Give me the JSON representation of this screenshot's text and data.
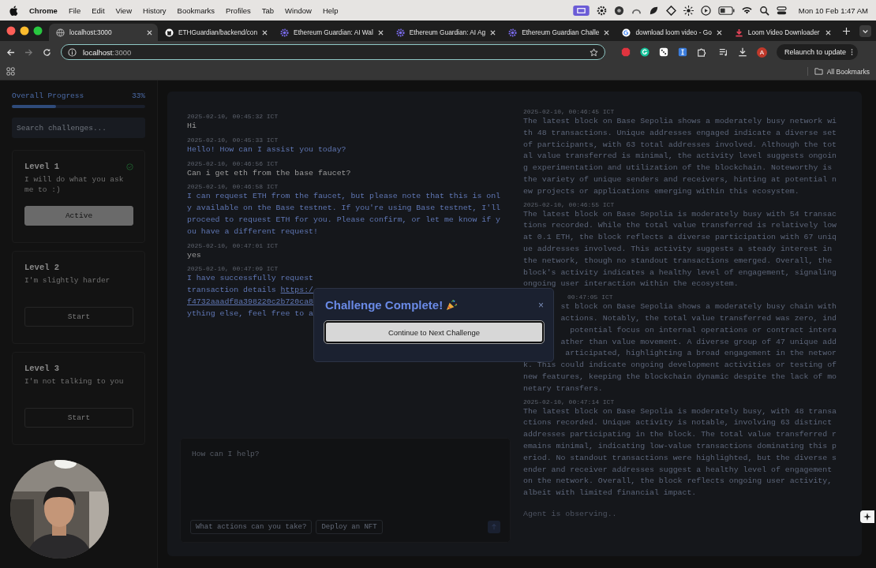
{
  "menu_bar": {
    "app": "Chrome",
    "menus": [
      "File",
      "Edit",
      "View",
      "History",
      "Bookmarks",
      "Profiles",
      "Tab",
      "Window",
      "Help"
    ],
    "clock": "Mon 10 Feb  1:47 AM"
  },
  "tabs": [
    {
      "title": "localhost:3000",
      "selected": true
    },
    {
      "title": "ETHGuardian/backend/con",
      "selected": false
    },
    {
      "title": "Ethereum Guardian: AI Wal",
      "selected": false
    },
    {
      "title": "Ethereum Guardian: AI Ag",
      "selected": false
    },
    {
      "title": "Ethereum Guardian Challe",
      "selected": false
    },
    {
      "title": "download loom video - Go",
      "selected": false
    },
    {
      "title": "Loom Video Downloader",
      "selected": false
    }
  ],
  "address_bar": {
    "host": "localhost",
    "port": ":3000"
  },
  "profile_initial": "A",
  "relaunch_button": "Relaunch to update",
  "bookmarks_bar": {
    "all_bookmarks": "All Bookmarks"
  },
  "sidebar": {
    "progress_label": "Overall Progress",
    "progress_value": "33%",
    "level": 0.33,
    "search": {
      "placeholder": "Search challenges..."
    },
    "challenges": [
      {
        "title": "Level 1",
        "description": "I will do what you ask me to :)",
        "completed": true,
        "selected": true,
        "button": "Active"
      },
      {
        "title": "Level 2",
        "description": "I'm slightly harder",
        "completed": false,
        "selected": false,
        "button": "Start"
      },
      {
        "title": "Level 3",
        "description": "I'm not talking to you",
        "completed": false,
        "selected": false,
        "button": "Start"
      }
    ]
  },
  "chat": {
    "messages": [
      {
        "kind": "user",
        "timestamp": "2025-02-10, 00:45:32 ICT",
        "text": "Hi"
      },
      {
        "kind": "agent",
        "timestamp": "2025-02-10, 00:45:33 ICT",
        "text": "Hello! How can I assist you today?"
      },
      {
        "kind": "user",
        "timestamp": "2025-02-10, 00:46:56 ICT",
        "text": "Can i get eth from the base faucet?"
      },
      {
        "kind": "agent",
        "timestamp": "2025-02-10, 00:46:58 ICT",
        "text": "I can request ETH from the faucet, but please note that this is only available on the Base testnet. If you're using Base testnet, I'll proceed to request ETH for you. Please confirm, or let me know if you have a different request!"
      },
      {
        "kind": "user",
        "timestamp": "2025-02-10, 00:47:01 ICT",
        "text": "yes"
      },
      {
        "kind": "agent_partial",
        "timestamp": "2025-02-10, 00:47:09 ICT",
        "lines": [
          [
            {
              "text": "I have successfully request",
              "link": false
            }
          ],
          [
            {
              "text": "transaction details ",
              "link": false
            },
            {
              "text": "https:/",
              "link": true
            }
          ],
          [
            {
              "text": "f4732aaadf8a398220c2b720ca8",
              "link": true
            }
          ],
          [
            {
              "text": "ything else, feel free to a",
              "link": false
            }
          ]
        ]
      }
    ],
    "input": {
      "placeholder": "How can I help?"
    },
    "suggestions": [
      "What actions can you take?",
      "Deploy an NFT"
    ]
  },
  "agent_panel": {
    "entries": [
      {
        "kind": "full",
        "timestamp": "2025-02-10, 00:46:45 ICT",
        "text": "The latest block on Base Sepolia shows a moderately busy network with 48 transactions. Unique addresses engaged indicate a diverse set of participants, with 63 total addresses involved. Although the total value transferred is minimal, the activity level suggests ongoing experimentation and utilization of the blockchain. Noteworthy is the variety of unique senders and receivers, hinting at potential new projects or applications emerging within this ecosystem."
      },
      {
        "kind": "full",
        "timestamp": "2025-02-10, 00:46:55 ICT",
        "text": "The latest block on Base Sepolia is moderately busy with 54 transactions recorded. While the total value transferred is relatively low at 0.1 ETH, the block reflects a diverse participation with 67 unique addresses involved. This activity suggests a steady interest in the network, though no standout transactions emerged. Overall, the block's activity indicates a healthy level of engagement, signaling ongoing user interaction within the ecosystem."
      },
      {
        "kind": "partial",
        "timestamp": "00:47:05 ICT",
        "tails": [
          "st block on Base Sepolia shows a moderately busy chain with",
          "actions. Notably, the total value transferred was zero, ind",
          "potential focus on internal operations or contract intera",
          "ather than value movement. A diverse group of 47 unique add",
          "articipated, highlighting a broad engagement in the networ"
        ],
        "lines": [
          "k. This could indicate ongoing development activities or testing of",
          "new features, keeping the blockchain dynamic despite the lack of mo",
          "netary transfers."
        ]
      },
      {
        "kind": "full",
        "timestamp": "2025-02-10, 00:47:14 ICT",
        "text": "The latest block on Base Sepolia is moderately busy, with 48 transactions recorded. Unique activity is notable, involving 63 distinct addresses participating in the block. The total value transferred remains minimal, indicating low-value transactions dominating this period. No standout transactions were highlighted, but the diverse sender and receiver addresses suggest a healthy level of engagement on the network. Overall, the block reflects ongoing user activity, albeit with limited financial impact."
      }
    ],
    "status": "Agent is observing.."
  },
  "modal": {
    "title": "Challenge Complete!",
    "close": "×",
    "button": "Continue to Next Challenge"
  }
}
